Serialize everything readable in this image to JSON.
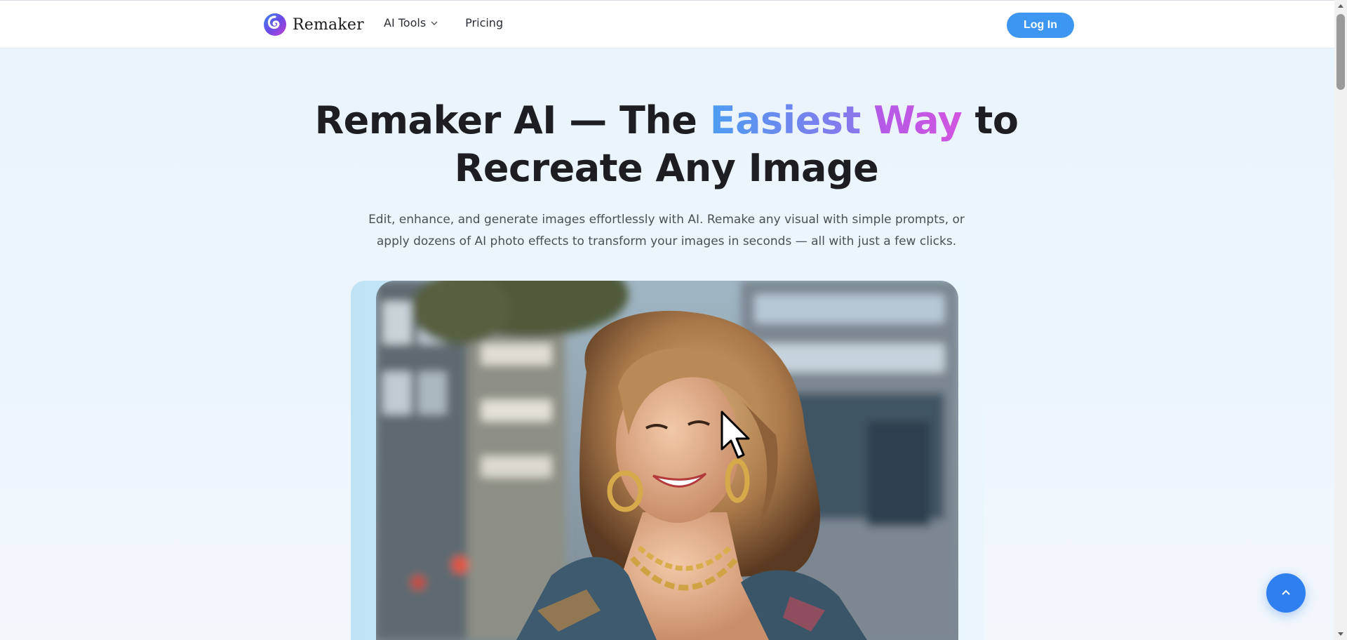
{
  "header": {
    "brand_name": "Remaker",
    "logo_icon": "remaker-swirl-logo",
    "nav": [
      {
        "label": "AI Tools",
        "has_dropdown": true
      },
      {
        "label": "Pricing",
        "has_dropdown": false
      }
    ],
    "login_label": "Log In"
  },
  "hero": {
    "title_part1": "Remaker AI — The ",
    "title_highlight1": "Easiest",
    "title_highlight2": "Way",
    "title_part2": " to",
    "title_line2": "Recreate Any Image",
    "subtitle": "Edit, enhance, and generate images effortlessly with AI. Remake any visual with simple prompts, or apply dozens of AI photo effects to transform your images in seconds — all with just a few clicks."
  },
  "showcase": {
    "image_icon": "portrait-photo",
    "subject": "smiling woman with wavy blonde hair, gold hoop earrings and gold chain necklace, city street background"
  },
  "scroll_top": {
    "icon": "chevron-up-icon"
  },
  "colors": {
    "accent": "#3d97f0",
    "gradient_blue": "#4d9cf2",
    "gradient_purple": "#d154e0",
    "scroll_button": "#2f7ff0"
  }
}
